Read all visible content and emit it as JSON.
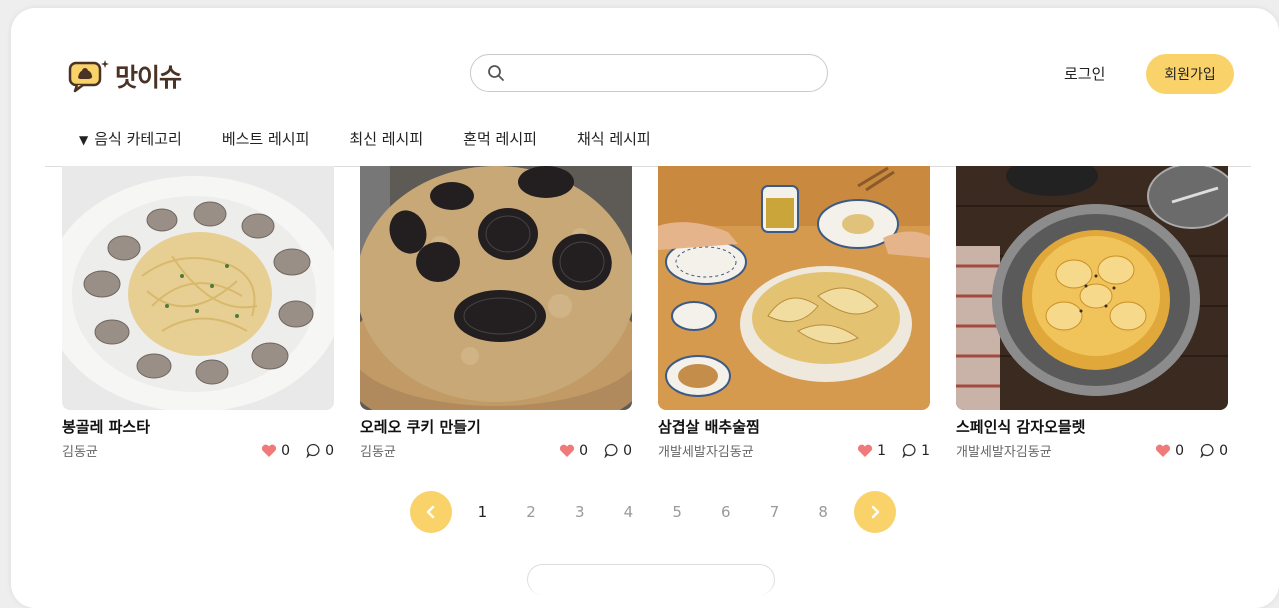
{
  "header": {
    "logo_text": "맛이슈",
    "search_placeholder": "",
    "login_label": "로그인",
    "signup_label": "회원가입"
  },
  "nav": {
    "category_label": "음식 카테고리",
    "items": [
      "베스트 레시피",
      "최신 레시피",
      "혼먹 레시피",
      "채식 레시피"
    ]
  },
  "recipes": [
    {
      "title": "봉골레 파스타",
      "author": "김동균",
      "likes": "0",
      "comments": "0"
    },
    {
      "title": "오레오 쿠키 만들기",
      "author": "김동균",
      "likes": "0",
      "comments": "0"
    },
    {
      "title": "삼겹살 배추술찜",
      "author": "개발세발자김동균",
      "likes": "1",
      "comments": "1"
    },
    {
      "title": "스페인식 감자오믈렛",
      "author": "개발세발자김동균",
      "likes": "0",
      "comments": "0"
    }
  ],
  "pagination": {
    "pages": [
      "1",
      "2",
      "3",
      "4",
      "5",
      "6",
      "7",
      "8"
    ],
    "current": "1"
  },
  "colors": {
    "accent": "#f9d26a",
    "heart": "#f07a7a",
    "logo_text": "#4a3325"
  },
  "icons": {
    "search": "search-icon",
    "heart": "heart-icon",
    "comment": "comment-icon",
    "prev": "chevron-left-icon",
    "next": "chevron-right-icon",
    "caret": "caret-down-icon"
  }
}
